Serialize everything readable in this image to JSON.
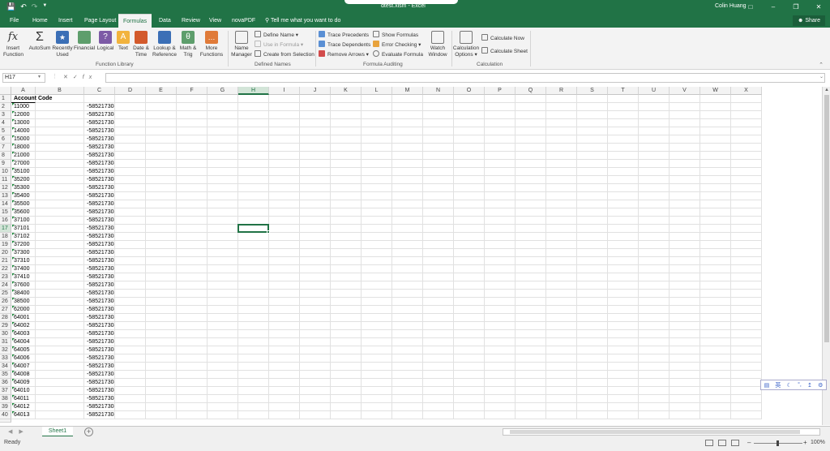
{
  "app": {
    "title": "dtest.xlsm - Excel",
    "user": "Colin Huang",
    "share_label": "Share",
    "tell_me": "Tell me what you want to do",
    "accent": "#217346"
  },
  "tabs": [
    "File",
    "Home",
    "Insert",
    "Page Layout",
    "Formulas",
    "Data",
    "Review",
    "View",
    "novaPDF"
  ],
  "active_tab": "Formulas",
  "ribbon": {
    "function_library": {
      "label": "Function Library",
      "buttons": [
        {
          "l1": "Insert",
          "l2": "Function",
          "icon": "fx-icon"
        },
        {
          "l1": "AutoSum",
          "l2": "",
          "icon": "sigma-icon"
        },
        {
          "l1": "Recently",
          "l2": "Used",
          "icon": "star-book-icon"
        },
        {
          "l1": "Financial",
          "l2": "",
          "icon": "money-book-icon"
        },
        {
          "l1": "Logical",
          "l2": "",
          "icon": "question-book-icon"
        },
        {
          "l1": "Text",
          "l2": "",
          "icon": "text-book-icon"
        },
        {
          "l1": "Date &",
          "l2": "Time",
          "icon": "calendar-book-icon"
        },
        {
          "l1": "Lookup &",
          "l2": "Reference",
          "icon": "magnifier-book-icon"
        },
        {
          "l1": "Math &",
          "l2": "Trig",
          "icon": "theta-book-icon"
        },
        {
          "l1": "More",
          "l2": "Functions",
          "icon": "dots-book-icon"
        }
      ]
    },
    "defined_names": {
      "label": "Defined Names",
      "name_manager": [
        "Name",
        "Manager"
      ],
      "items": [
        "Define Name",
        "Use in Formula",
        "Create from Selection"
      ]
    },
    "formula_auditing": {
      "label": "Formula Auditing",
      "items_left": [
        "Trace Precedents",
        "Trace Dependents",
        "Remove Arrows"
      ],
      "items_right": [
        "Show Formulas",
        "Error Checking",
        "Evaluate Formula"
      ],
      "watch": [
        "Watch",
        "Window"
      ]
    },
    "calculation": {
      "label": "Calculation",
      "options": [
        "Calculation",
        "Options"
      ],
      "items": [
        "Calculate Now",
        "Calculate Sheet"
      ]
    }
  },
  "formula_bar": {
    "name_box": "H17",
    "content": ""
  },
  "columns": [
    "A",
    "B",
    "C",
    "D",
    "E",
    "F",
    "G",
    "H",
    "I",
    "J",
    "K",
    "L",
    "M",
    "N",
    "O",
    "P",
    "Q",
    "R",
    "S",
    "T",
    "U",
    "V",
    "W",
    "X"
  ],
  "selected_cell": {
    "col": "H",
    "row": "17"
  },
  "header_cell": "Account Code",
  "rows": [
    {
      "n": "1",
      "a": "Account Code",
      "c": ""
    },
    {
      "n": "2",
      "a": "11000",
      "c": "-585217308.3"
    },
    {
      "n": "3",
      "a": "12000",
      "c": "-585217308.3"
    },
    {
      "n": "4",
      "a": "13000",
      "c": "-585217308.3"
    },
    {
      "n": "5",
      "a": "14000",
      "c": "-585217308.3"
    },
    {
      "n": "6",
      "a": "15000",
      "c": "-585217308.3"
    },
    {
      "n": "7",
      "a": "18000",
      "c": "-585217308.3"
    },
    {
      "n": "8",
      "a": "21000",
      "c": "-585217308.3"
    },
    {
      "n": "9",
      "a": "27000",
      "c": "-585217308.3"
    },
    {
      "n": "10",
      "a": "35100",
      "c": "-585217308.3"
    },
    {
      "n": "11",
      "a": "35200",
      "c": "-585217308.3"
    },
    {
      "n": "12",
      "a": "35300",
      "c": "-585217308.3"
    },
    {
      "n": "13",
      "a": "35400",
      "c": "-585217308.3"
    },
    {
      "n": "14",
      "a": "35500",
      "c": "-585217308.3"
    },
    {
      "n": "15",
      "a": "35600",
      "c": "-585217308.3"
    },
    {
      "n": "16",
      "a": "37100",
      "c": "-585217308.3"
    },
    {
      "n": "17",
      "a": "37101",
      "c": "-585217308.3"
    },
    {
      "n": "18",
      "a": "37102",
      "c": "-585217308.3"
    },
    {
      "n": "19",
      "a": "37200",
      "c": "-585217308.3"
    },
    {
      "n": "20",
      "a": "37300",
      "c": "-585217308.3"
    },
    {
      "n": "21",
      "a": "37310",
      "c": "-585217308.3"
    },
    {
      "n": "22",
      "a": "37400",
      "c": "-585217308.3"
    },
    {
      "n": "23",
      "a": "37410",
      "c": "-585217308.3"
    },
    {
      "n": "24",
      "a": "37600",
      "c": "-585217308.3"
    },
    {
      "n": "25",
      "a": "38400",
      "c": "-585217308.3"
    },
    {
      "n": "26",
      "a": "38500",
      "c": "-585217308.3"
    },
    {
      "n": "27",
      "a": "62000",
      "c": "-585217308.3"
    },
    {
      "n": "28",
      "a": "64001",
      "c": "-585217308.3"
    },
    {
      "n": "29",
      "a": "64002",
      "c": "-585217308.3"
    },
    {
      "n": "30",
      "a": "64003",
      "c": "-585217308.3"
    },
    {
      "n": "31",
      "a": "64004",
      "c": "-585217308.3"
    },
    {
      "n": "32",
      "a": "64005",
      "c": "-585217308.3"
    },
    {
      "n": "33",
      "a": "64006",
      "c": "-585217308.3"
    },
    {
      "n": "34",
      "a": "64007",
      "c": "-585217308.3"
    },
    {
      "n": "35",
      "a": "64008",
      "c": "-585217308.3"
    },
    {
      "n": "36",
      "a": "64009",
      "c": "-585217308.3"
    },
    {
      "n": "37",
      "a": "64010",
      "c": "-585217308.3"
    },
    {
      "n": "38",
      "a": "64011",
      "c": "-585217308.3"
    },
    {
      "n": "39",
      "a": "64012",
      "c": "-585217308.3"
    },
    {
      "n": "40",
      "a": "64013",
      "c": "-585217308.3"
    }
  ],
  "sheet_tab": "Sheet1",
  "status": {
    "ready": "Ready",
    "zoom": "100%"
  },
  "ime": [
    "英"
  ]
}
